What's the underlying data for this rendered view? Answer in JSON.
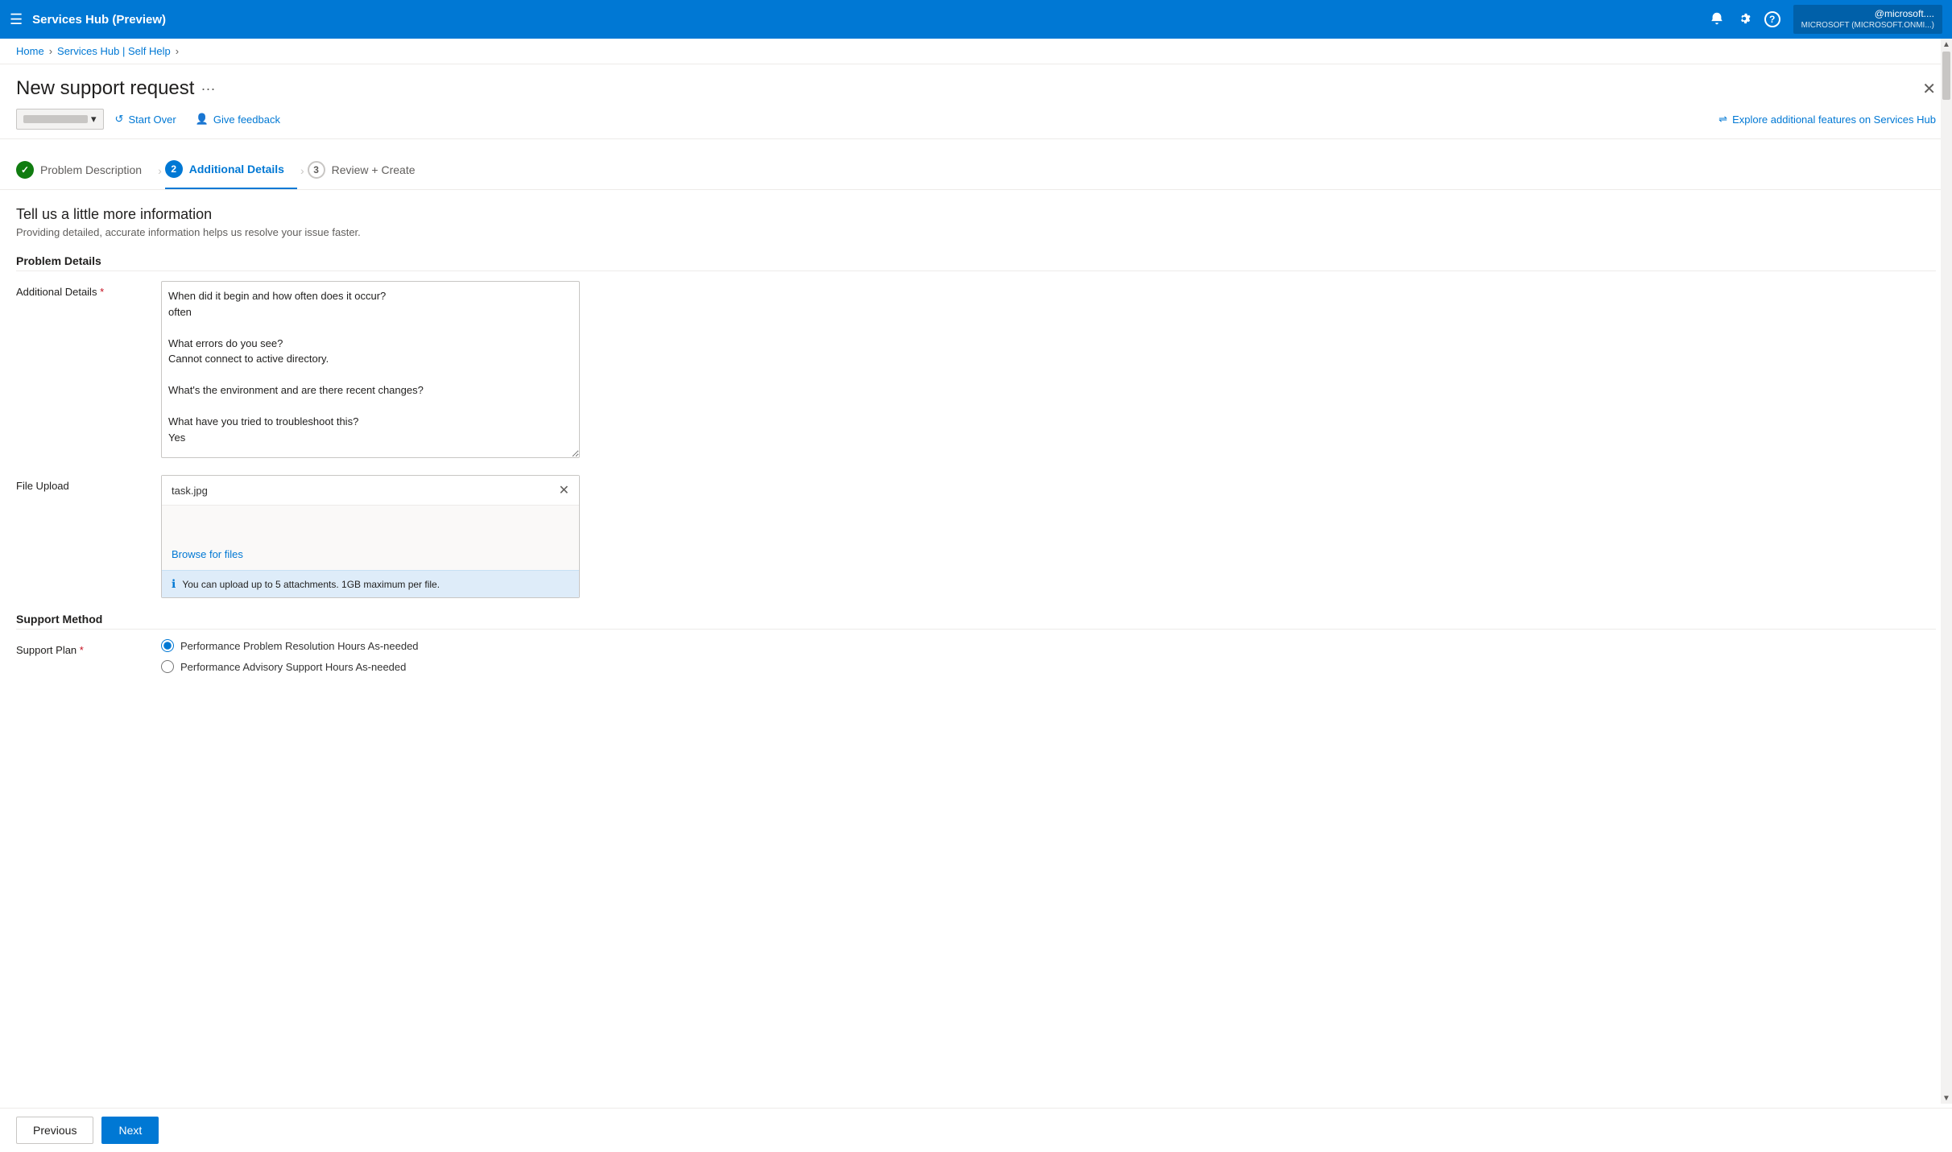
{
  "topbar": {
    "hamburger_icon": "☰",
    "app_title": "Services Hub (Preview)",
    "bell_icon": "🔔",
    "gear_icon": "⚙",
    "help_icon": "?",
    "user_email": "@microsoft....",
    "user_tenant": "MICROSOFT (MICROSOFT.ONMI...)"
  },
  "breadcrumb": {
    "items": [
      "Home",
      "Services Hub | Self Help"
    ],
    "separators": [
      ">",
      ">"
    ]
  },
  "page": {
    "title": "New support request",
    "dots_label": "···",
    "close_label": "✕"
  },
  "toolbar": {
    "dropdown_placeholder": "─────────",
    "start_over_label": "Start Over",
    "give_feedback_label": "Give feedback",
    "explore_label": "Explore additional features on Services Hub",
    "refresh_icon": "↺",
    "feedback_icon": "👤",
    "explore_icon": "≡"
  },
  "steps": [
    {
      "id": "problem-description",
      "number": "✓",
      "label": "Problem Description",
      "state": "done"
    },
    {
      "id": "additional-details",
      "number": "2",
      "label": "Additional Details",
      "state": "active"
    },
    {
      "id": "review-create",
      "number": "3",
      "label": "Review + Create",
      "state": "pending"
    }
  ],
  "section": {
    "title": "Tell us a little more information",
    "subtitle": "Providing detailed, accurate information helps us resolve your issue faster."
  },
  "problem_details": {
    "group_title": "Problem Details",
    "additional_details_label": "Additional Details",
    "additional_details_required": true,
    "additional_details_value": "When did it begin and how often does it occur?\noften\n\nWhat errors do you see?\nCannot connect to active directory.\n\nWhat's the environment and are there recent changes?\n\nWhat have you tried to troubleshoot this?\nYes",
    "file_upload_label": "File Upload",
    "file_name": "task.jpg",
    "browse_label": "Browse for files",
    "file_info": "You can upload up to 5 attachments. 1GB maximum per file."
  },
  "support_method": {
    "group_title": "Support Method",
    "support_plan_label": "Support Plan",
    "support_plan_required": true,
    "options": [
      {
        "id": "perf",
        "label": "Performance Problem Resolution Hours As-needed",
        "selected": true
      },
      {
        "id": "advisory",
        "label": "Performance Advisory Support Hours As-needed",
        "selected": false
      }
    ]
  },
  "footer": {
    "previous_label": "Previous",
    "next_label": "Next"
  }
}
